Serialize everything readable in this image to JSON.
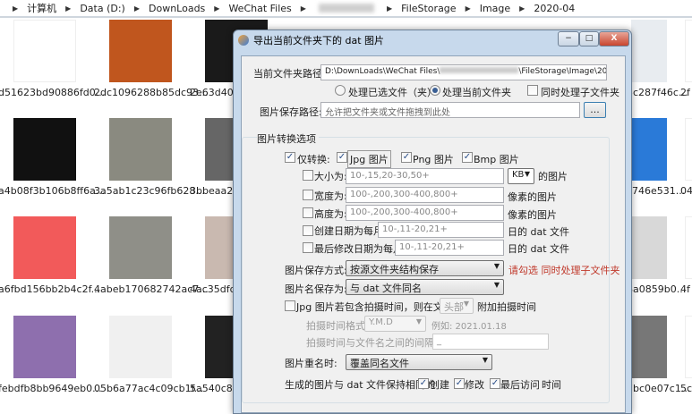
{
  "address_bar": {
    "crumbs": [
      "计算机",
      "Data (D:)",
      "DownLoads",
      "WeChat Files",
      "FileStorage",
      "Image",
      "2020-04"
    ]
  },
  "files": [
    {
      "name": "d51623bd90886fd0...",
      "color": "#ffffff"
    },
    {
      "name": "2dc1096288b85dc93...",
      "color": "#c0561e"
    },
    {
      "name": "2e63d407",
      "color": "#1a1a1a"
    },
    {
      "name": "3c287f46c...",
      "color": "#e8ecf0"
    },
    {
      "name": "2f",
      "color": "#ffffff"
    },
    {
      "name": "a4b08f3b106b8ff6a...",
      "color": "#111111"
    },
    {
      "name": "3a5ab1c23c96fb628...",
      "color": "#8a8a80"
    },
    {
      "name": "3bbeaa29",
      "color": "#666666"
    },
    {
      "name": "c746e531...",
      "color": "#2a7ad8"
    },
    {
      "name": "04",
      "color": "#ffffff"
    },
    {
      "name": "a6fbd156bb2b4c2f...",
      "color": "#f25a5a"
    },
    {
      "name": "4abeb170682742ac7...",
      "color": "#8f8f88"
    },
    {
      "name": "4ac35dfd",
      "color": "#c9b9b0"
    },
    {
      "name": "8a0859b0...",
      "color": "#d8d8d8"
    },
    {
      "name": "4f",
      "color": "#ffffff"
    },
    {
      "name": "febdfb8bb9649eb0...",
      "color": "#8e6fae"
    },
    {
      "name": "05b6a77ac4c09cb1f...",
      "color": "#f0f0f0"
    },
    {
      "name": "5a540c89",
      "color": "#222222"
    },
    {
      "name": "7bc0e07c1...",
      "color": "#777777"
    },
    {
      "name": "5c",
      "color": "#ffffff"
    }
  ],
  "dialog": {
    "title": "导出当前文件夹下的 dat 图片",
    "window_buttons": {
      "minimize": "−",
      "maximize": "□",
      "close": "X"
    },
    "current_path_label": "当前文件夹路径:",
    "current_path_value": "D:\\DownLoads\\WeChat Files\\",
    "current_path_suffix": "\\FileStorage\\Image\\2020-04",
    "radio_selected_files": "处理已选文件（夹）",
    "radio_current_folder": "处理当前文件夹",
    "radio_current_folder_checked": true,
    "checkbox_subfolders": "同时处理子文件夹",
    "save_path_label": "图片保存路径:",
    "save_path_placeholder": "允许把文件夹或文件拖拽到此处",
    "browse_button": "...",
    "group_title": "图片转换选项",
    "only_convert": "仅转换:",
    "jpg": "Jpg 图片",
    "png": "Png 图片",
    "bmp": "Bmp 图片",
    "size_label": "大小为:",
    "size_placeholder": "10-,15,20-30,50+",
    "size_unit": "KB",
    "size_suffix": "的图片",
    "width_label": "宽度为:",
    "width_placeholder": "100-,200,300-400,800+",
    "width_suffix": "像素的图片",
    "height_label": "高度为:",
    "height_placeholder": "100-,200,300-400,800+",
    "height_suffix": "像素的图片",
    "created_label": "创建日期为每月",
    "created_placeholder": "10-,11-20,21+",
    "created_suffix": "日的 dat 文件",
    "modified_label": "最后修改日期为每月",
    "modified_placeholder": "10-,11-20,21+",
    "modified_suffix": "日的 dat 文件",
    "save_mode_label": "图片保存方式:",
    "save_mode_value": "按源文件夹结构保存",
    "save_mode_hint": "请勾选 同时处理子文件夹",
    "name_label": "图片名保存为:",
    "name_value": "与 dat 文件同名",
    "jpg_time_label": "Jpg 图片若包含拍摄时间，则在文件名",
    "jpg_time_pos": "头部",
    "jpg_time_suffix": "附加拍摄时间",
    "time_format_label": "拍摄时间格式:",
    "time_format_value": "Y.M.D",
    "time_format_example": "例如: 2021.01.18",
    "separator_label": "拍摄时间与文件名之间的间隔符:",
    "separator_value": "_",
    "rename_label": "图片重名时:",
    "rename_value": "覆盖同名文件",
    "keep_time_label": "生成的图片与 dat 文件保持相同的",
    "keep_created": "创建",
    "keep_modified": "修改",
    "keep_accessed": "最后访问",
    "keep_time_suffix": "时间",
    "hint_color": "#c0392b"
  }
}
